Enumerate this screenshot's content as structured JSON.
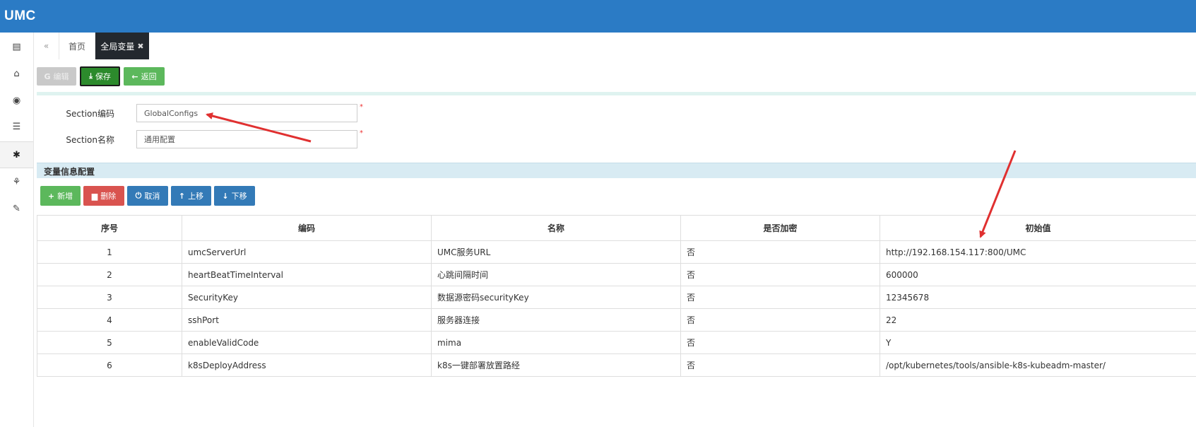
{
  "app": {
    "logo": "UMC"
  },
  "sidebar": {
    "items": [
      {
        "name": "sidebar-item-card",
        "icon": "▤"
      },
      {
        "name": "sidebar-item-bank",
        "icon": "⌂"
      },
      {
        "name": "sidebar-item-eye",
        "icon": "◉"
      },
      {
        "name": "sidebar-item-list",
        "icon": "☰"
      },
      {
        "name": "sidebar-item-settings",
        "icon": "✱",
        "active": true
      },
      {
        "name": "sidebar-item-puzzle",
        "icon": "⚘"
      },
      {
        "name": "sidebar-item-wrench",
        "icon": "✎"
      }
    ]
  },
  "tabs": {
    "back_icon": "«",
    "home": "首页",
    "active": "全局变量",
    "close": "✖"
  },
  "toolbar": {
    "edit_label": "编辑",
    "save_label": "保存",
    "back_label": "返回"
  },
  "form": {
    "section_code_label": "Section编码",
    "section_code_value": "GlobalConfigs",
    "section_name_label": "Section名称",
    "section_name_value": "通用配置",
    "required_mark": "*"
  },
  "variables": {
    "title": "变量信息配置",
    "buttons": {
      "add": "新增",
      "delete": "删除",
      "cancel": "取消",
      "up": "上移",
      "down": "下移"
    },
    "columns": [
      "序号",
      "编码",
      "名称",
      "是否加密",
      "初始值"
    ],
    "rows": [
      {
        "idx": "1",
        "code": "umcServerUrl",
        "name": "UMC服务URL",
        "encrypted": "否",
        "value": "http://192.168.154.117:800/UMC"
      },
      {
        "idx": "2",
        "code": "heartBeatTimeInterval",
        "name": "心跳间隔时间",
        "encrypted": "否",
        "value": "600000"
      },
      {
        "idx": "3",
        "code": "SecurityKey",
        "name": "数据源密码securityKey",
        "encrypted": "否",
        "value": "12345678"
      },
      {
        "idx": "4",
        "code": "sshPort",
        "name": "服务器连接",
        "encrypted": "否",
        "value": "22"
      },
      {
        "idx": "5",
        "code": "enableValidCode",
        "name": "mima",
        "encrypted": "否",
        "value": "Y"
      },
      {
        "idx": "6",
        "code": "k8sDeployAddress",
        "name": "k8s一键部署放置路经",
        "encrypted": "否",
        "value": "/opt/kubernetes/tools/ansible-k8s-kubeadm-master/"
      }
    ]
  },
  "colors": {
    "topbar": "#2b7bc5",
    "annotation_arrow": "#e03030"
  }
}
